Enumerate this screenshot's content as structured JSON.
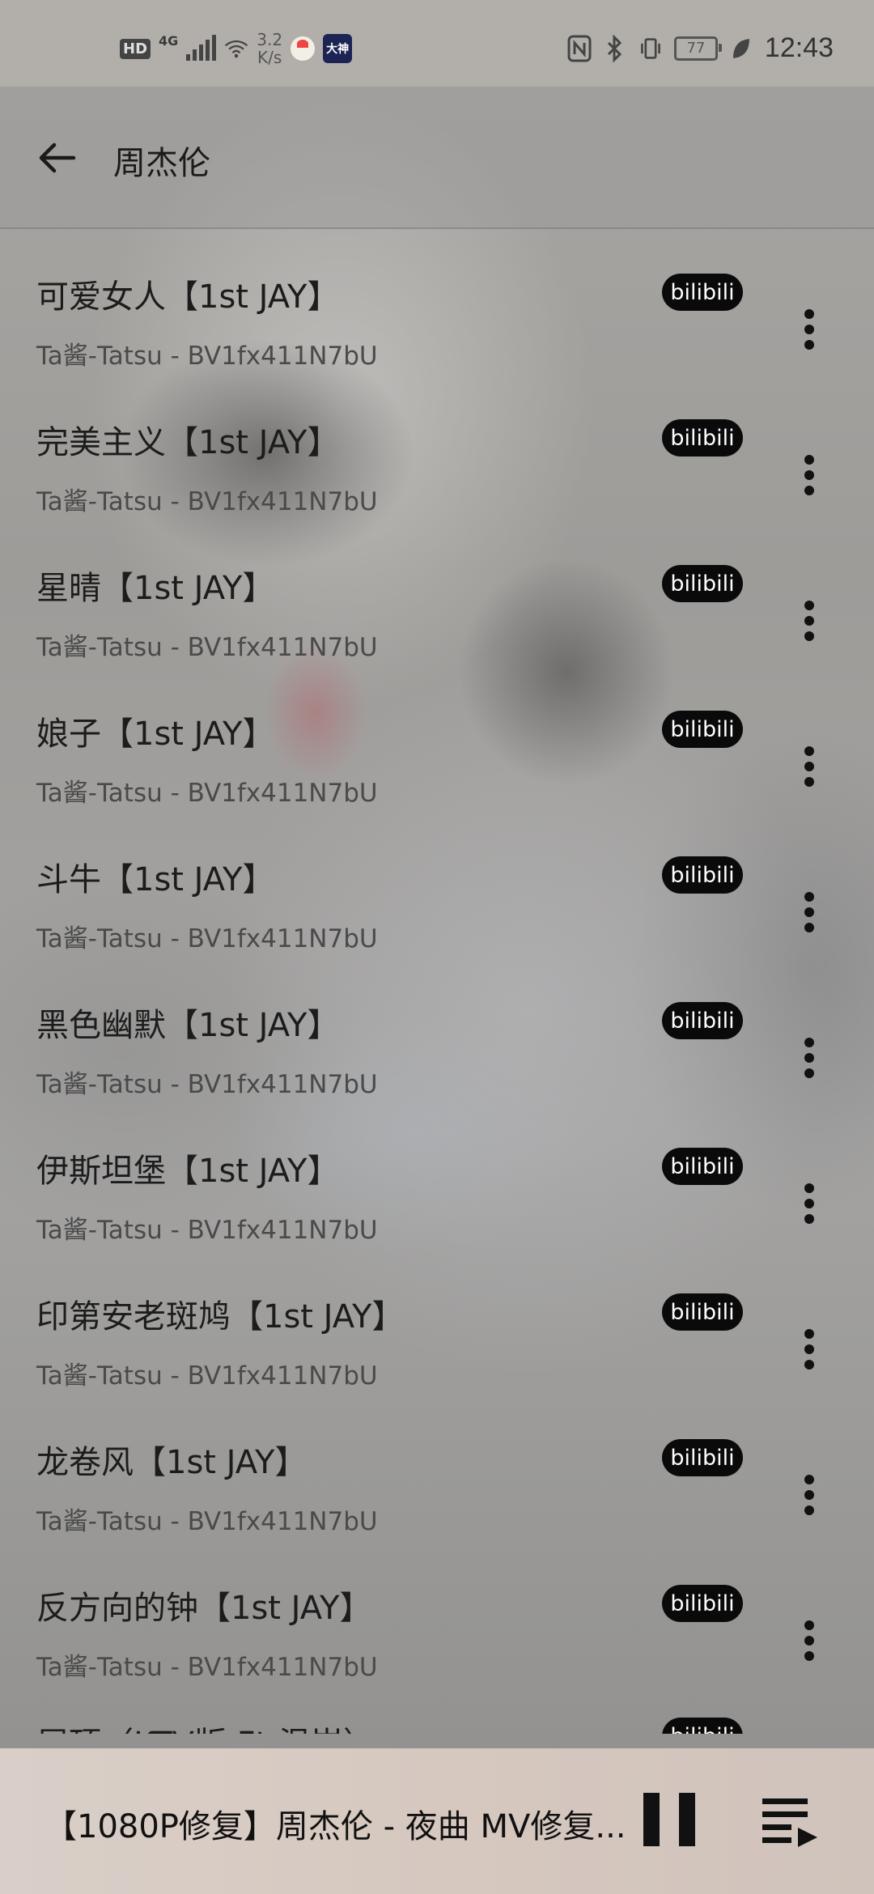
{
  "status_bar": {
    "hd": "HD",
    "network": "4G",
    "speed_value": "3.2",
    "speed_unit": "K/s",
    "app2_label": "大神",
    "battery": "77",
    "time": "12:43"
  },
  "header": {
    "title": "周杰伦",
    "back_icon": "arrow-left-icon"
  },
  "songs": [
    {
      "title": "可爱女人【1st JAY】",
      "subtitle": "Ta酱-Tatsu - BV1fx411N7bU",
      "badge": "bilibili"
    },
    {
      "title": "完美主义【1st JAY】",
      "subtitle": "Ta酱-Tatsu - BV1fx411N7bU",
      "badge": "bilibili"
    },
    {
      "title": "星晴【1st JAY】",
      "subtitle": "Ta酱-Tatsu - BV1fx411N7bU",
      "badge": "bilibili"
    },
    {
      "title": "娘子【1st JAY】",
      "subtitle": "Ta酱-Tatsu - BV1fx411N7bU",
      "badge": "bilibili"
    },
    {
      "title": "斗牛【1st JAY】",
      "subtitle": "Ta酱-Tatsu - BV1fx411N7bU",
      "badge": "bilibili"
    },
    {
      "title": "黑色幽默【1st JAY】",
      "subtitle": "Ta酱-Tatsu - BV1fx411N7bU",
      "badge": "bilibili"
    },
    {
      "title": "伊斯坦堡【1st JAY】",
      "subtitle": "Ta酱-Tatsu - BV1fx411N7bU",
      "badge": "bilibili"
    },
    {
      "title": "印第安老斑鸠【1st JAY】",
      "subtitle": "Ta酱-Tatsu - BV1fx411N7bU",
      "badge": "bilibili"
    },
    {
      "title": "龙卷风【1st JAY】",
      "subtitle": "Ta酱-Tatsu - BV1fx411N7bU",
      "badge": "bilibili"
    },
    {
      "title": "反方向的钟【1st JAY】",
      "subtitle": "Ta酱-Tatsu - BV1fx411N7bU",
      "badge": "bilibili"
    },
    {
      "title": "屋顶（KTV版 Ft.温岚）",
      "subtitle": "",
      "badge": "bilibili"
    }
  ],
  "player": {
    "now_playing": "【1080P修复】周杰伦 - 夜曲 MV修复...",
    "pause_icon": "pause-icon",
    "queue_icon": "playlist-queue-icon"
  },
  "colors": {
    "badge_bg": "#0a0a0a",
    "badge_text": "#ffffff",
    "player_bg": "#d6c8bf"
  }
}
